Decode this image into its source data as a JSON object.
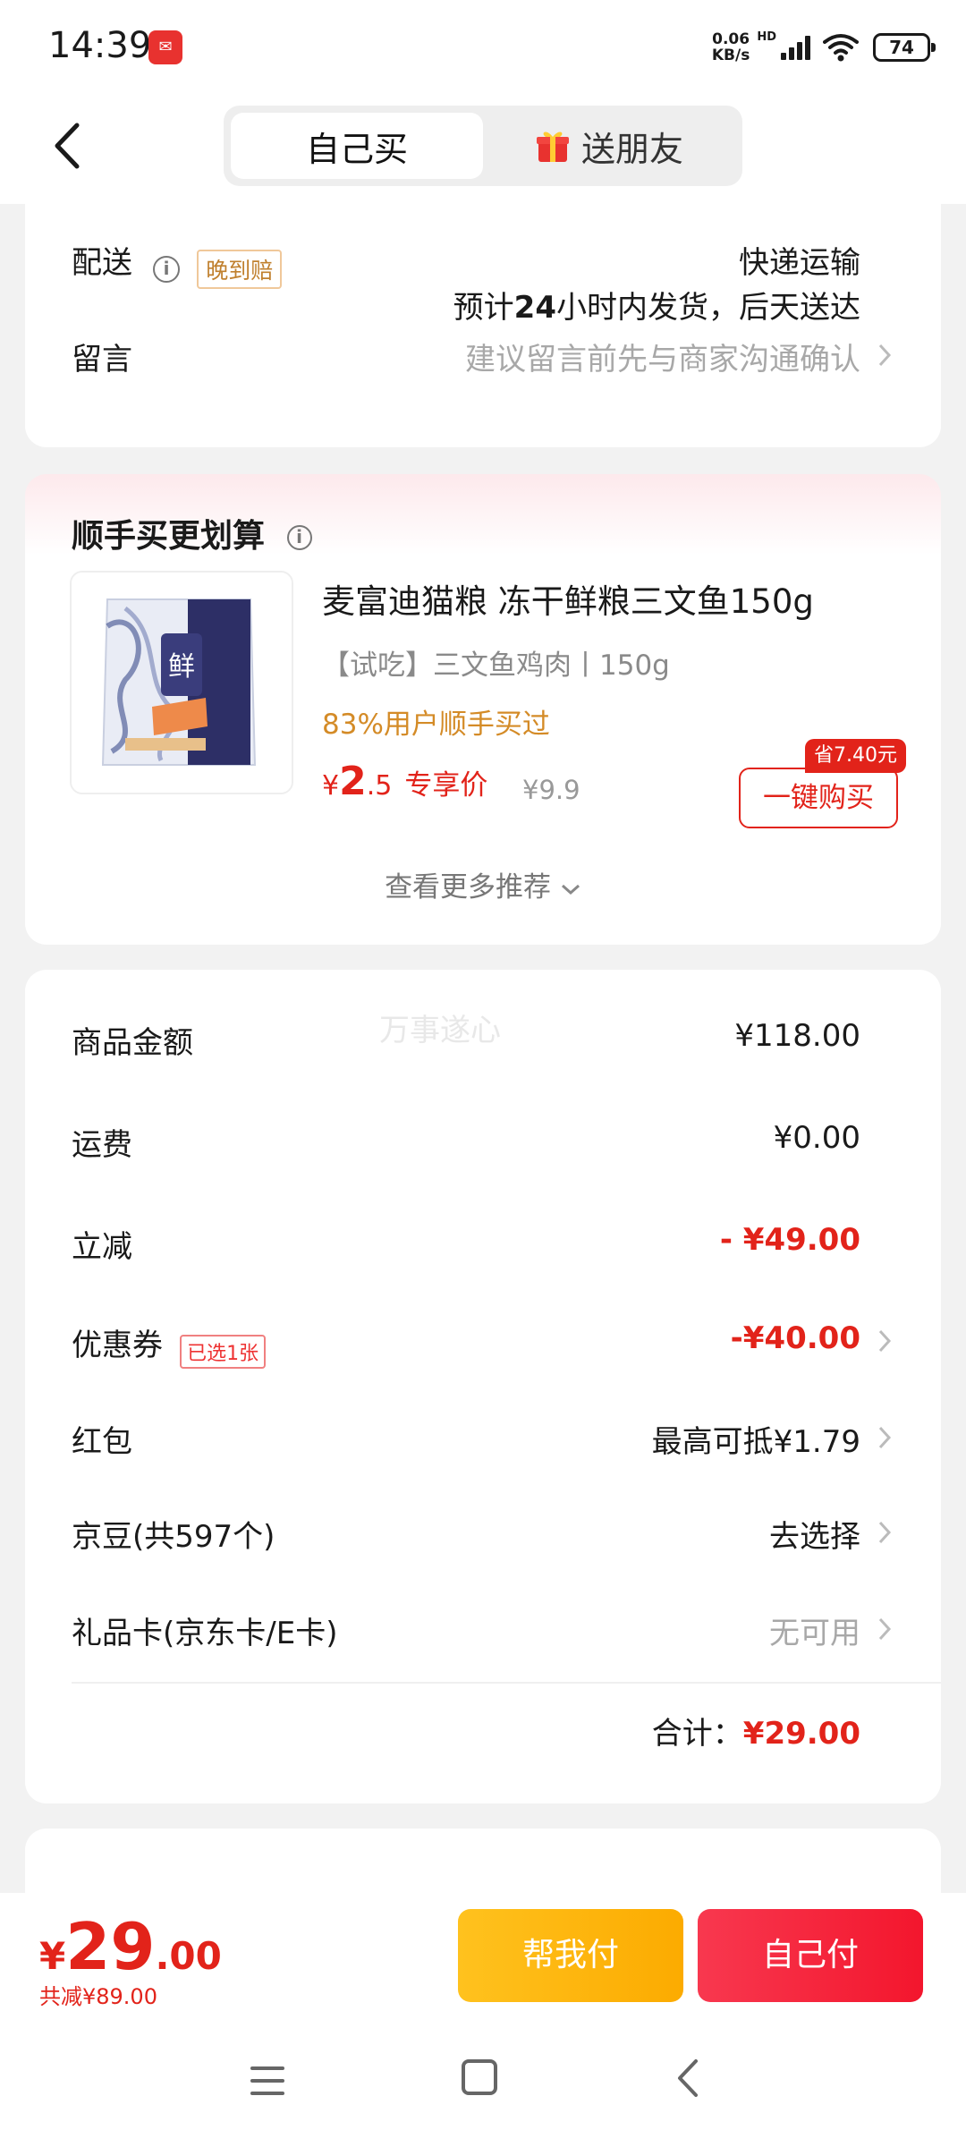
{
  "status_bar": {
    "time": "14:39",
    "net_speed_top": "0.06",
    "net_speed_bottom": "KB/s",
    "hd": "HD",
    "battery": "74"
  },
  "header": {
    "tab_self": "自己买",
    "tab_gift": "送朋友"
  },
  "delivery": {
    "label": "配送",
    "late_tag": "晚到赔",
    "method": "快递运输",
    "eta_prefix": "预计",
    "eta_hours": "24",
    "eta_suffix": "小时内发货，后天送达"
  },
  "message": {
    "label": "留言",
    "placeholder": "建议留言前先与商家沟通确认"
  },
  "recommend": {
    "title": "顺手买更划算",
    "product": {
      "image_label": "鲜",
      "name": "麦富迪猫粮 冻干鲜粮三文鱼150g",
      "spec": "【试吃】三文鱼鸡肉丨150g",
      "social": "83%用户顺手买过",
      "currency": "¥",
      "price_int": "2",
      "price_dec": ".5",
      "price_label": "专享价",
      "orig_price": "¥9.9",
      "save_badge": "省7.40元",
      "buy_label": "一键购买"
    },
    "more": "查看更多推荐"
  },
  "summary": {
    "watermark": "万事遂心",
    "goods_label": "商品金额",
    "goods_value": "¥118.00",
    "freight_label": "运费",
    "freight_value": "¥0.00",
    "discount_label": "立减",
    "discount_value": "- ¥49.00",
    "coupon_label": "优惠券",
    "coupon_tag": "已选1张",
    "coupon_value": "-¥40.00",
    "redpacket_label": "红包",
    "redpacket_value": "最高可抵¥1.79",
    "jingdou_label": "京豆(共597个)",
    "jingdou_value": "去选择",
    "giftcard_label": "礼品卡(京东卡/E卡)",
    "giftcard_value": "无可用",
    "total_label": "合计：",
    "total_value": "¥29.00"
  },
  "bottom": {
    "currency": "¥",
    "total_int": "29",
    "total_dec": ".00",
    "saved": "共减¥89.00",
    "help_pay": "帮我付",
    "self_pay": "自己付"
  },
  "colors": {
    "accent_red": "#e2231a",
    "orange": "#d48b27",
    "yellow_btn": "#ffc21e",
    "red_btn": "#f3162d"
  }
}
